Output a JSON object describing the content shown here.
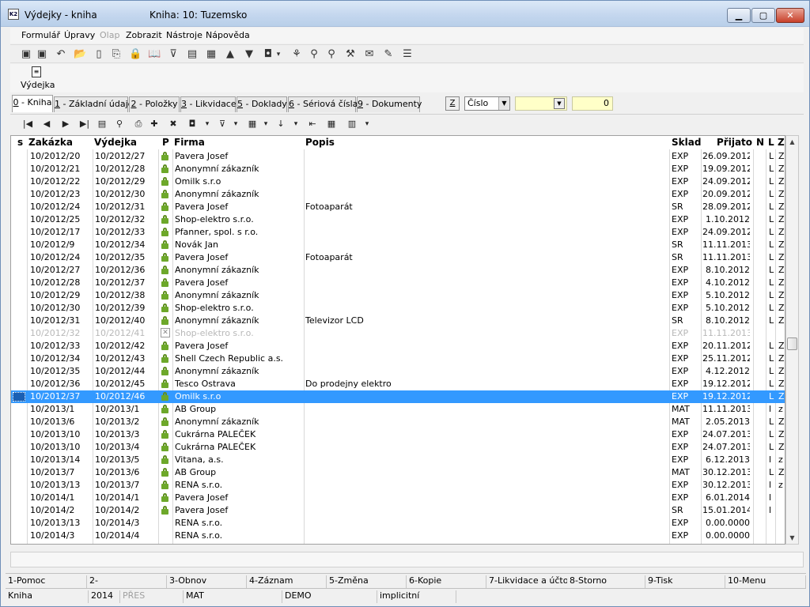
{
  "window": {
    "title": "Výdejky - kniha",
    "book": "Kniha: 10: Tuzemsko",
    "min": "▁",
    "max": "▢",
    "close": "✕",
    "icon_text": "K2"
  },
  "menu": [
    {
      "label": "Formulář",
      "disabled": false
    },
    {
      "label": "Úpravy",
      "disabled": false
    },
    {
      "label": "Olap",
      "disabled": true
    },
    {
      "label": "Zobrazit",
      "disabled": false
    },
    {
      "label": "Nástroje",
      "disabled": false
    },
    {
      "label": "Nápověda",
      "disabled": false
    }
  ],
  "action": {
    "label": "Výdejka"
  },
  "tabs": [
    {
      "key": "0",
      "label": " - Kniha",
      "active": true
    },
    {
      "key": "1",
      "label": " - Základní údaje",
      "active": false
    },
    {
      "key": "2",
      "label": " - Položky",
      "active": false
    },
    {
      "key": "3",
      "label": " - Likvidace",
      "active": false
    },
    {
      "key": "5",
      "label": " - Doklady",
      "active": false
    },
    {
      "key": "6",
      "label": " - Sériová čísla",
      "active": false
    },
    {
      "key": "9",
      "label": " - Dokumenty",
      "active": false
    }
  ],
  "sort": {
    "z_label": "Z",
    "field": "Číslo",
    "count": "0"
  },
  "columns": {
    "s": "s",
    "zakazka": "Zakázka",
    "vydejka": "Výdejka",
    "p": "P",
    "firma": "Firma",
    "popis": "Popis",
    "sklad": "Sklad",
    "prijato": "Přijato",
    "n": "N",
    "l": "L",
    "z": "Z"
  },
  "rows": [
    {
      "zakazka": "10/2012/20",
      "vydejka": "10/2012/27",
      "p": "lock",
      "firma": "Pavera Josef",
      "popis": "",
      "sklad": "EXP",
      "prijato": "26.09.2012",
      "l": "L",
      "z": "Z",
      "state": "normal"
    },
    {
      "zakazka": "10/2012/21",
      "vydejka": "10/2012/28",
      "p": "lock",
      "firma": "Anonymní zákazník",
      "popis": "",
      "sklad": "EXP",
      "prijato": "19.09.2012",
      "l": "L",
      "z": "Z",
      "state": "normal"
    },
    {
      "zakazka": "10/2012/22",
      "vydejka": "10/2012/29",
      "p": "lock",
      "firma": "Omilk s.r.o",
      "popis": "",
      "sklad": "EXP",
      "prijato": "24.09.2012",
      "l": "L",
      "z": "Z",
      "state": "normal"
    },
    {
      "zakazka": "10/2012/23",
      "vydejka": "10/2012/30",
      "p": "lock",
      "firma": "Anonymní zákazník",
      "popis": "",
      "sklad": "EXP",
      "prijato": "20.09.2012",
      "l": "L",
      "z": "Z",
      "state": "normal"
    },
    {
      "zakazka": "10/2012/24",
      "vydejka": "10/2012/31",
      "p": "lock",
      "firma": "Pavera Josef",
      "popis": "Fotoaparát",
      "sklad": "SR",
      "prijato": "28.09.2012",
      "l": "L",
      "z": "Z",
      "state": "normal"
    },
    {
      "zakazka": "10/2012/25",
      "vydejka": "10/2012/32",
      "p": "lock",
      "firma": "Shop-elektro s.r.o.",
      "popis": "",
      "sklad": "EXP",
      "prijato": "1.10.2012",
      "l": "L",
      "z": "Z",
      "state": "normal"
    },
    {
      "zakazka": "10/2012/17",
      "vydejka": "10/2012/33",
      "p": "lock",
      "firma": "Pfanner, spol. s r.o.",
      "popis": "",
      "sklad": "EXP",
      "prijato": "24.09.2012",
      "l": "L",
      "z": "Z",
      "state": "normal"
    },
    {
      "zakazka": "10/2012/9",
      "vydejka": "10/2012/34",
      "p": "lock",
      "firma": "Novák Jan",
      "popis": "",
      "sklad": "SR",
      "prijato": "11.11.2013",
      "l": "L",
      "z": "Z",
      "state": "normal"
    },
    {
      "zakazka": "10/2012/24",
      "vydejka": "10/2012/35",
      "p": "lock",
      "firma": "Pavera Josef",
      "popis": "Fotoaparát",
      "sklad": "SR",
      "prijato": "11.11.2013",
      "l": "L",
      "z": "Z",
      "state": "normal"
    },
    {
      "zakazka": "10/2012/27",
      "vydejka": "10/2012/36",
      "p": "lock",
      "firma": "Anonymní zákazník",
      "popis": "",
      "sklad": "EXP",
      "prijato": "8.10.2012",
      "l": "L",
      "z": "Z",
      "state": "normal"
    },
    {
      "zakazka": "10/2012/28",
      "vydejka": "10/2012/37",
      "p": "lock",
      "firma": "Pavera Josef",
      "popis": "",
      "sklad": "EXP",
      "prijato": "4.10.2012",
      "l": "L",
      "z": "Z",
      "state": "normal"
    },
    {
      "zakazka": "10/2012/29",
      "vydejka": "10/2012/38",
      "p": "lock",
      "firma": "Anonymní zákazník",
      "popis": "",
      "sklad": "EXP",
      "prijato": "5.10.2012",
      "l": "L",
      "z": "Z",
      "state": "normal"
    },
    {
      "zakazka": "10/2012/30",
      "vydejka": "10/2012/39",
      "p": "lock",
      "firma": "Shop-elektro s.r.o.",
      "popis": "",
      "sklad": "EXP",
      "prijato": "5.10.2012",
      "l": "L",
      "z": "Z",
      "state": "normal"
    },
    {
      "zakazka": "10/2012/31",
      "vydejka": "10/2012/40",
      "p": "lock",
      "firma": "Anonymní zákazník",
      "popis": "Televizor LCD",
      "sklad": "SR",
      "prijato": "8.10.2012",
      "l": "L",
      "z": "Z",
      "state": "normal"
    },
    {
      "zakazka": "10/2012/32",
      "vydejka": "10/2012/41",
      "p": "cancel",
      "firma": "Shop-elektro s.r.o.",
      "popis": "",
      "sklad": "EXP",
      "prijato": "11.11.2013",
      "l": "",
      "z": "",
      "state": "inactive"
    },
    {
      "zakazka": "10/2012/33",
      "vydejka": "10/2012/42",
      "p": "lock",
      "firma": "Pavera Josef",
      "popis": "",
      "sklad": "EXP",
      "prijato": "20.11.2012",
      "l": "L",
      "z": "Z",
      "state": "normal"
    },
    {
      "zakazka": "10/2012/34",
      "vydejka": "10/2012/43",
      "p": "lock",
      "firma": "Shell Czech Republic a.s.",
      "popis": "",
      "sklad": "EXP",
      "prijato": "25.11.2012",
      "l": "L",
      "z": "Z",
      "state": "normal"
    },
    {
      "zakazka": "10/2012/35",
      "vydejka": "10/2012/44",
      "p": "lock",
      "firma": "Anonymní zákazník",
      "popis": "",
      "sklad": "EXP",
      "prijato": "4.12.2012",
      "l": "L",
      "z": "Z",
      "state": "normal"
    },
    {
      "zakazka": "10/2012/36",
      "vydejka": "10/2012/45",
      "p": "lock",
      "firma": "Tesco Ostrava",
      "popis": "Do prodejny elektro",
      "sklad": "EXP",
      "prijato": "19.12.2012",
      "l": "L",
      "z": "Z",
      "state": "normal"
    },
    {
      "zakazka": "10/2012/37",
      "vydejka": "10/2012/46",
      "p": "lock",
      "firma": "Omilk s.r.o",
      "popis": "",
      "sklad": "EXP",
      "prijato": "19.12.2012",
      "l": "L",
      "z": "Z",
      "state": "selected"
    },
    {
      "zakazka": "10/2013/1",
      "vydejka": "10/2013/1",
      "p": "lock",
      "firma": "AB Group",
      "popis": "",
      "sklad": "MAT",
      "prijato": "11.11.2013",
      "l": "l",
      "z": "z",
      "state": "normal"
    },
    {
      "zakazka": "10/2013/6",
      "vydejka": "10/2013/2",
      "p": "lock",
      "firma": "Anonymní zákazník",
      "popis": "",
      "sklad": "MAT",
      "prijato": "2.05.2013",
      "l": "L",
      "z": "Z",
      "state": "normal"
    },
    {
      "zakazka": "10/2013/10",
      "vydejka": "10/2013/3",
      "p": "lock",
      "firma": "Cukrárna PALEČEK",
      "popis": "",
      "sklad": "EXP",
      "prijato": "24.07.2013",
      "l": "L",
      "z": "Z",
      "state": "normal"
    },
    {
      "zakazka": "10/2013/10",
      "vydejka": "10/2013/4",
      "p": "lock",
      "firma": "Cukrárna PALEČEK",
      "popis": "",
      "sklad": "EXP",
      "prijato": "24.07.2013",
      "l": "L",
      "z": "Z",
      "state": "normal"
    },
    {
      "zakazka": "10/2013/14",
      "vydejka": "10/2013/5",
      "p": "lock",
      "firma": "Vitana, a.s.",
      "popis": "",
      "sklad": "EXP",
      "prijato": "6.12.2013",
      "l": "l",
      "z": "z",
      "state": "normal"
    },
    {
      "zakazka": "10/2013/7",
      "vydejka": "10/2013/6",
      "p": "lock",
      "firma": "AB Group",
      "popis": "",
      "sklad": "MAT",
      "prijato": "30.12.2013",
      "l": "L",
      "z": "Z",
      "state": "normal"
    },
    {
      "zakazka": "10/2013/13",
      "vydejka": "10/2013/7",
      "p": "lock",
      "firma": "RENA s.r.o.",
      "popis": "",
      "sklad": "EXP",
      "prijato": "30.12.2013",
      "l": "l",
      "z": "z",
      "state": "normal"
    },
    {
      "zakazka": "10/2014/1",
      "vydejka": "10/2014/1",
      "p": "lock",
      "firma": "Pavera Josef",
      "popis": "",
      "sklad": "EXP",
      "prijato": "6.01.2014",
      "l": "l",
      "z": "",
      "state": "normal"
    },
    {
      "zakazka": "10/2014/2",
      "vydejka": "10/2014/2",
      "p": "lock",
      "firma": "Pavera Josef",
      "popis": "",
      "sklad": "SR",
      "prijato": "15.01.2014",
      "l": "l",
      "z": "",
      "state": "normal"
    },
    {
      "zakazka": "10/2013/13",
      "vydejka": "10/2014/3",
      "p": "",
      "firma": "RENA s.r.o.",
      "popis": "",
      "sklad": "EXP",
      "prijato": "0.00.0000",
      "l": "",
      "z": "",
      "state": "normal"
    },
    {
      "zakazka": "10/2014/3",
      "vydejka": "10/2014/4",
      "p": "",
      "firma": "RENA s.r.o.",
      "popis": "",
      "sklad": "EXP",
      "prijato": "0.00.0000",
      "l": "",
      "z": "",
      "state": "normal"
    }
  ],
  "fkeys": [
    "1-Pomoc",
    "2-",
    "3-Obnov",
    "4-Záznam",
    "5-Změna",
    "6-Kopie",
    "7-Likvidace a účtová",
    "8-Storno",
    "9-Tisk",
    "10-Menu"
  ],
  "status": [
    {
      "text": "Kniha",
      "dim": false
    },
    {
      "text": "2014",
      "dim": false
    },
    {
      "text": "PŘES",
      "dim": true
    },
    {
      "text": "MAT",
      "dim": false
    },
    {
      "text": "DEMO",
      "dim": false
    },
    {
      "text": "implicitní",
      "dim": false
    }
  ],
  "icons": {
    "toolbar": [
      "save-icon",
      "save-all-icon",
      "undo-icon",
      "open-folder-icon",
      "new-document-icon",
      "copy-icon",
      "lock-icon",
      "book-icon",
      "filter-icon",
      "filter-document-icon",
      "stack-icon",
      "arrow-up-icon",
      "arrow-down-icon",
      "camera-icon",
      "dropdown-icon",
      "tree-icon",
      "binoculars-icon",
      "binoculars-filter-icon",
      "tools-icon",
      "envelope-icon",
      "edit-icon",
      "menu-icon"
    ],
    "toolbar_glyphs": [
      "▣",
      "▣",
      "↶",
      "📂",
      "▯",
      "⎘",
      "🔒",
      "📖",
      "⊽",
      "▤",
      "▦",
      "▲",
      "▼",
      "◘",
      "▾",
      "⚘",
      "⚲",
      "⚲",
      "⚒",
      "✉",
      "✎",
      "☰"
    ],
    "nav": [
      "first-record-icon",
      "previous-record-icon",
      "next-record-icon",
      "last-record-icon",
      "document-icon",
      "binoculars-icon",
      "print-icon",
      "add-item-icon",
      "remove-item-icon",
      "camera-icon",
      "dropdown-icon",
      "filter-icon",
      "dropdown-icon",
      "table-icon",
      "dropdown-icon",
      "sort-icon",
      "dropdown-icon",
      "columns-icon",
      "export-icon",
      "notes-icon",
      "dropdown-icon"
    ],
    "nav_glyphs": [
      "|◀",
      "◀",
      "▶",
      "▶|",
      "▤",
      "⚲",
      "⎙",
      "✚",
      "✖",
      "◘",
      "▾",
      "⊽",
      "▾",
      "▦",
      "▾",
      "↓",
      "▾",
      "⇤",
      "▦",
      "▥",
      "▾"
    ]
  }
}
